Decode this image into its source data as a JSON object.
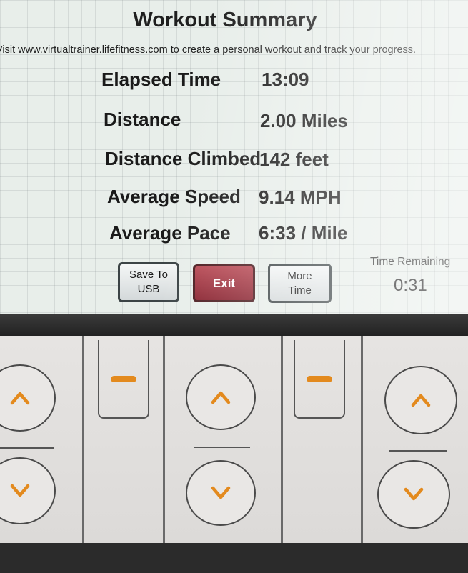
{
  "screen": {
    "title": "Workout Summary",
    "subtitle": "Visit www.virtualtrainer.lifefitness.com to create a personal workout and track your progress.",
    "stats": [
      {
        "label": "Elapsed Time",
        "value": "13:09"
      },
      {
        "label": "Distance",
        "value": "2.00 Miles"
      },
      {
        "label": "Distance Climbed",
        "value": "142 feet"
      },
      {
        "label": "Average Speed",
        "value": "9.14 MPH"
      },
      {
        "label": "Average Pace",
        "value": "6:33 / Mile"
      }
    ],
    "buttons": {
      "save_line1": "Save To",
      "save_line2": "USB",
      "exit": "Exit",
      "more_line1": "More",
      "more_line2": "Time"
    },
    "time_remaining": {
      "label": "Time Remaining",
      "value": "0:31"
    }
  },
  "keypad": {
    "accent_color": "#e38a1e",
    "icons": [
      "chevron-up-icon",
      "chevron-down-icon",
      "minus-icon"
    ]
  }
}
